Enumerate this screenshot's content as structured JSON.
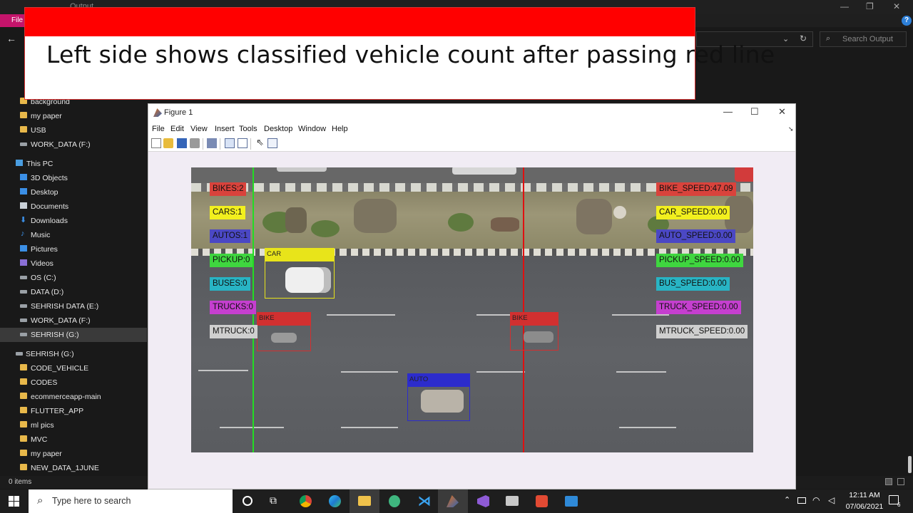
{
  "explorer": {
    "title": "Output",
    "file_tab": "File",
    "search_placeholder": "Search Output",
    "status_count": "0 items",
    "nav_items": [
      {
        "label": "background"
      },
      {
        "label": "my paper"
      },
      {
        "label": "USB"
      },
      {
        "label": "WORK_DATA (F:)"
      },
      {
        "label": "This PC"
      },
      {
        "label": "3D Objects"
      },
      {
        "label": "Desktop"
      },
      {
        "label": "Documents"
      },
      {
        "label": "Downloads"
      },
      {
        "label": "Music"
      },
      {
        "label": "Pictures"
      },
      {
        "label": "Videos"
      },
      {
        "label": "OS (C:)"
      },
      {
        "label": "DATA (D:)"
      },
      {
        "label": "SEHRISH DATA (E:)"
      },
      {
        "label": "WORK_DATA (F:)"
      },
      {
        "label": "SEHRISH (G:)"
      },
      {
        "label": "SEHRISH (G:)"
      },
      {
        "label": "CODE_VEHICLE"
      },
      {
        "label": "CODES"
      },
      {
        "label": "ecommerceapp-main"
      },
      {
        "label": "FLUTTER_APP"
      },
      {
        "label": "ml pics"
      },
      {
        "label": "MVC"
      },
      {
        "label": "my paper"
      },
      {
        "label": "NEW_DATA_1JUNE"
      }
    ]
  },
  "caption": {
    "text": "Left side shows classified vehicle count after passing red line"
  },
  "figure": {
    "title": "Figure 1",
    "menu": [
      "File",
      "Edit",
      "View",
      "Insert",
      "Tools",
      "Desktop",
      "Window",
      "Help"
    ],
    "counts": [
      {
        "label": "BIKES:2",
        "color": "#d9433c"
      },
      {
        "label": "CARS:1",
        "color": "#f2f01e"
      },
      {
        "label": "AUTOS:1",
        "color": "#4b48c4"
      },
      {
        "label": "PICKUP:0",
        "color": "#3fd63f"
      },
      {
        "label": "BUSES:0",
        "color": "#28b4c4"
      },
      {
        "label": "TRUCKS:0",
        "color": "#c53fcf"
      },
      {
        "label": "MTRUCK:0",
        "color": "#cfcfcf"
      }
    ],
    "speeds": [
      {
        "label": "BIKE_SPEED:47.09",
        "color": "#d9433c"
      },
      {
        "label": "CAR_SPEED:0.00",
        "color": "#f2f01e"
      },
      {
        "label": "AUTO_SPEED:0.00",
        "color": "#4b48c4"
      },
      {
        "label": "PICKUP_SPEED:0.00",
        "color": "#3fd63f"
      },
      {
        "label": "BUS_SPEED:0.00",
        "color": "#28b4c4"
      },
      {
        "label": "TRUCK_SPEED:0.00",
        "color": "#c53fcf"
      },
      {
        "label": "MTRUCK_SPEED:0.00",
        "color": "#cfcfcf"
      }
    ],
    "detections": [
      {
        "label": "CAR",
        "color": "#e8e41a"
      },
      {
        "label": "BIKE",
        "color": "#d23030"
      },
      {
        "label": "BIKE",
        "color": "#d23030"
      },
      {
        "label": "AUTO",
        "color": "#2c2ccc"
      }
    ]
  },
  "taskbar": {
    "search_placeholder": "Type here to search",
    "time": "12:11 AM",
    "date": "07/06/2021",
    "notification_count": "6"
  }
}
